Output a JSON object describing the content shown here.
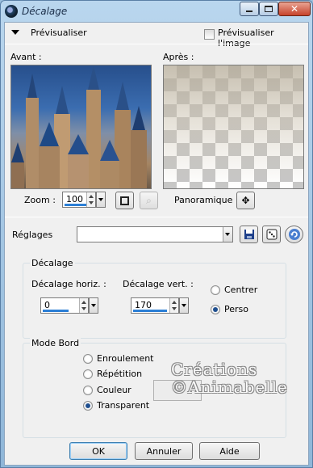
{
  "window": {
    "title": "Décalage"
  },
  "preview": {
    "header_label": "Prévisualiser",
    "preview_image_label": "Prévisualiser l'image",
    "before_label": "Avant :",
    "after_label": "Après :",
    "zoom_label": "Zoom :",
    "zoom_value": "100",
    "pan_label": "Panoramique :"
  },
  "settings": {
    "label": "Réglages",
    "preset_value": ""
  },
  "offset_group": {
    "title": "Décalage",
    "horizontal_label": "Décalage horiz. :",
    "horizontal_value": "0",
    "vertical_label": "Décalage vert. :",
    "vertical_value": "170",
    "center_label": "Centrer",
    "custom_label": "Perso",
    "selected": "Perso"
  },
  "edge_group": {
    "title": "Mode Bord",
    "options": [
      "Enroulement",
      "Répétition",
      "Couleur",
      "Transparent"
    ],
    "selected": "Transparent"
  },
  "watermark": {
    "line1": "Créations",
    "line2": "©Animabelle"
  },
  "buttons": {
    "ok": "OK",
    "cancel": "Annuler",
    "help": "Aide"
  }
}
